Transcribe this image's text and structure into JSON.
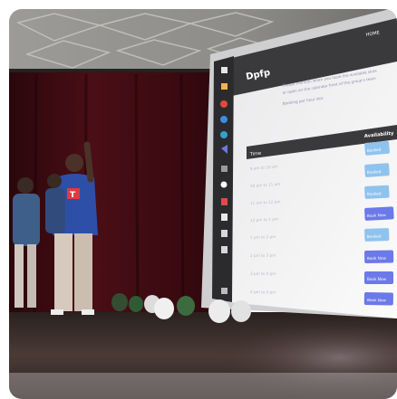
{
  "screen": {
    "nav_home": "HOME",
    "page_title": "Dpfp",
    "intro_line_1": "Please mention when you have the available slots",
    "intro_line_2": "or open on the calendar front of the group's team",
    "intro_line_3": "Booking per hour slot",
    "table_header_time": "Time",
    "table_header_availability": "Availability",
    "rows": [
      {
        "time": "9 am to 10 am",
        "status": "Booked"
      },
      {
        "time": "10 am to 11 am",
        "status": "Booked"
      },
      {
        "time": "11 am to 12 pm",
        "status": "Booked"
      },
      {
        "time": "12 pm to 1 pm",
        "status": "Book Now"
      },
      {
        "time": "1 pm to 2 pm",
        "status": "Booked"
      },
      {
        "time": "2 pm to 3 pm",
        "status": "Book Now"
      },
      {
        "time": "3 pm to 4 pm",
        "status": "Book Now"
      },
      {
        "time": "4 pm to 5 pm",
        "status": "Book Now"
      }
    ]
  },
  "presenter_badge": "T",
  "colors": {
    "screen_bg": "#f4f3f1",
    "header_dark": "#3a3a3d",
    "booked": "#8fc3ee",
    "book_now": "#6c79e8",
    "curtain": "#3a0b10",
    "stage": "#3a2a25"
  }
}
